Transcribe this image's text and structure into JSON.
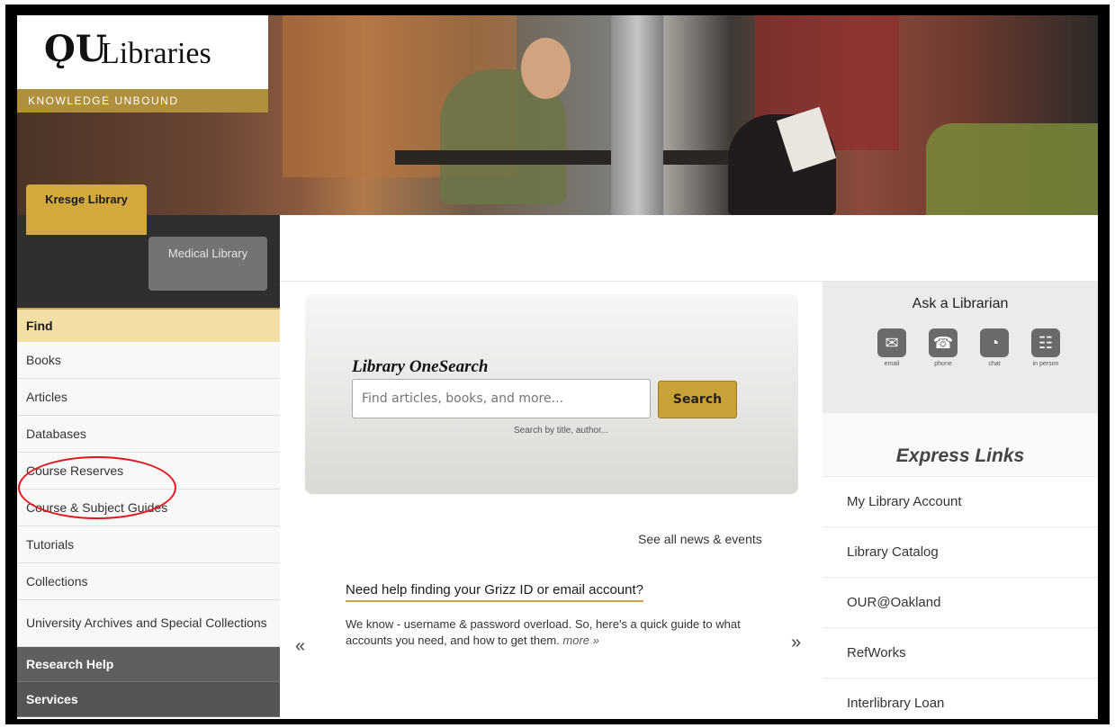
{
  "logo": {
    "mark": "ǪU",
    "name": "Libraries",
    "tagline": "KNOWLEDGE UNBOUND"
  },
  "library_tabs": {
    "kresge": "Kresge Library",
    "medical": "Medical Library"
  },
  "sidebar": {
    "find_heading": "Find",
    "items": [
      "Books",
      "Articles",
      "Databases",
      "Course Reserves",
      "Course & Subject Guides",
      "Tutorials",
      "Collections",
      "University Archives and Special Collections"
    ],
    "research_help": "Research Help",
    "services": "Services"
  },
  "search": {
    "title": "Library OneSearch",
    "placeholder": "Find articles, books, and more...",
    "button": "Search",
    "hint": "Search by title, author..."
  },
  "news": {
    "see_all": "See all news & events",
    "headline": "Need help finding your Grizz ID or email account?",
    "body": "We know - username & password overload. So, here's a quick guide to what accounts you need, and how to get them.",
    "more": "more »",
    "prev": "«",
    "next": "»"
  },
  "ask": {
    "title": "Ask a Librarian",
    "icons": [
      {
        "icon": "email-icon",
        "label": "email"
      },
      {
        "icon": "phone-icon",
        "label": "phone"
      },
      {
        "icon": "chat-icon",
        "label": "chat"
      },
      {
        "icon": "in-person-icon",
        "label": "in person"
      }
    ]
  },
  "express": {
    "title": "Express Links",
    "items": [
      "My Library Account",
      "Library Catalog",
      "OUR@Oakland",
      "RefWorks",
      "Interlibrary Loan"
    ]
  },
  "colors": {
    "gold": "#c9a237",
    "find_bg": "#f2dfa6",
    "annotation": "#e2161c"
  }
}
